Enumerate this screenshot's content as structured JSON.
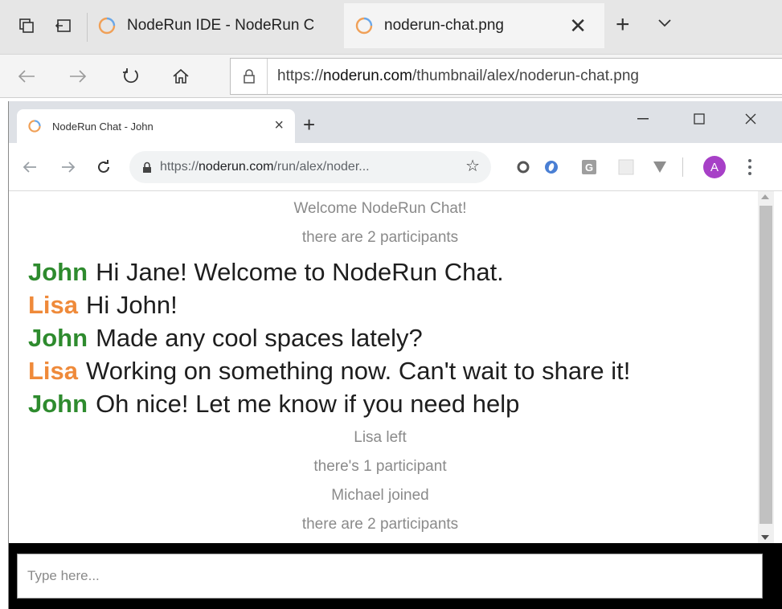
{
  "edge": {
    "tabs": [
      {
        "title": "NodeRun IDE - NodeRun Cl"
      },
      {
        "title": "noderun-chat.png"
      }
    ],
    "url": {
      "prefix": "https://",
      "host": "noderun.com",
      "path": "/thumbnail/alex/noderun-chat.png"
    }
  },
  "chrome": {
    "tab_title": "NodeRun Chat - John",
    "url": {
      "prefix": "https://",
      "host": "noderun.com",
      "path": "/run/alex/noder..."
    },
    "avatar_letter": "A"
  },
  "chat": {
    "header": [
      {
        "text": "Welcome NodeRun Chat!"
      },
      {
        "text": "there are 2 participants"
      }
    ],
    "messages": [
      {
        "user": "John",
        "text": "Hi Jane! Welcome to NodeRun Chat."
      },
      {
        "user": "Lisa",
        "text": "Hi John!"
      },
      {
        "user": "John",
        "text": "Made any cool spaces lately?"
      },
      {
        "user": "Lisa",
        "text": "Working on something now. Can't wait to share it!"
      },
      {
        "user": "John",
        "text": "Oh nice! Let me know if you need help"
      }
    ],
    "events": [
      {
        "text": "Lisa left"
      },
      {
        "text": "there's 1 participant"
      },
      {
        "text": "Michael joined"
      },
      {
        "text": "there are 2 participants"
      }
    ],
    "input_placeholder": "Type here..."
  },
  "colors": {
    "john": "#2e8b2e",
    "lisa": "#ef8a3a",
    "system_text": "#8a8a8a"
  }
}
